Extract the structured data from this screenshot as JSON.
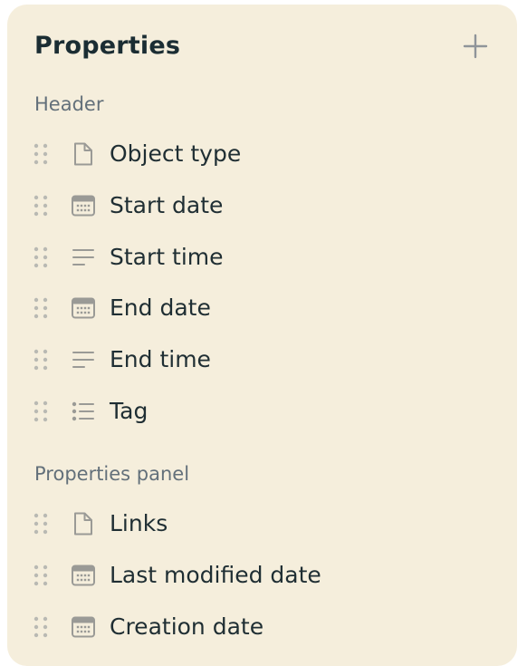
{
  "panel": {
    "title": "Properties",
    "add_icon": "plus-icon"
  },
  "sections": [
    {
      "label": "Header",
      "items": [
        {
          "label": "Object type",
          "icon": "file-icon"
        },
        {
          "label": "Start date",
          "icon": "calendar-icon"
        },
        {
          "label": "Start time",
          "icon": "text-lines-icon"
        },
        {
          "label": "End date",
          "icon": "calendar-icon"
        },
        {
          "label": "End time",
          "icon": "text-lines-icon"
        },
        {
          "label": "Tag",
          "icon": "list-icon"
        }
      ]
    },
    {
      "label": "Properties panel",
      "items": [
        {
          "label": "Links",
          "icon": "file-icon"
        },
        {
          "label": "Last modified date",
          "icon": "calendar-icon"
        },
        {
          "label": "Creation date",
          "icon": "calendar-icon"
        }
      ]
    }
  ],
  "colors": {
    "panel_bg": "#f5eedc",
    "title": "#1b2d33",
    "section_label": "#63707a",
    "icon": "#9a9a96"
  }
}
